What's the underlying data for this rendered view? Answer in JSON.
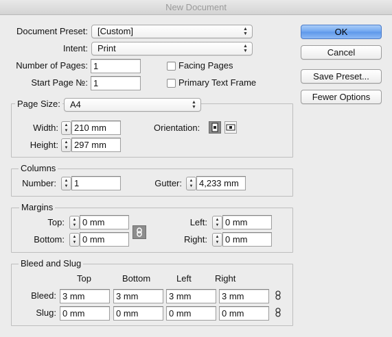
{
  "window": {
    "title": "New Document"
  },
  "document": {
    "preset_label": "Document Preset:",
    "preset_value": "[Custom]",
    "intent_label": "Intent:",
    "intent_value": "Print",
    "pages_label": "Number of Pages:",
    "pages_value": "1",
    "start_page_label": "Start Page №:",
    "start_page_value": "1",
    "facing_pages_label": "Facing Pages",
    "facing_pages_checked": false,
    "primary_text_frame_label": "Primary Text Frame",
    "primary_text_frame_checked": false
  },
  "buttons": {
    "ok": "OK",
    "cancel": "Cancel",
    "save_preset": "Save Preset...",
    "fewer_options": "Fewer Options"
  },
  "page_size": {
    "label": "Page Size:",
    "value": "A4",
    "width_label": "Width:",
    "width_value": "210 mm",
    "height_label": "Height:",
    "height_value": "297 mm",
    "orientation_label": "Orientation:",
    "orientation_selected": "portrait"
  },
  "columns": {
    "title": "Columns",
    "number_label": "Number:",
    "number_value": "1",
    "gutter_label": "Gutter:",
    "gutter_value": "4,233 mm"
  },
  "margins": {
    "title": "Margins",
    "top_label": "Top:",
    "top_value": "0 mm",
    "bottom_label": "Bottom:",
    "bottom_value": "0 mm",
    "left_label": "Left:",
    "left_value": "0 mm",
    "right_label": "Right:",
    "right_value": "0 mm"
  },
  "bleed_slug": {
    "title": "Bleed and Slug",
    "headers": [
      "Top",
      "Bottom",
      "Left",
      "Right"
    ],
    "bleed_label": "Bleed:",
    "bleed_values": [
      "3 mm",
      "3 mm",
      "3 mm",
      "3 mm"
    ],
    "slug_label": "Slug:",
    "slug_values": [
      "0 mm",
      "0 mm",
      "0 mm",
      "0 mm"
    ]
  },
  "icons": {
    "popup_arrows": "updown-arrows-icon",
    "stepper": "stepper-arrows-icon",
    "portrait": "portrait-orientation-icon",
    "landscape": "landscape-orientation-icon",
    "chain": "chain-link-icon"
  },
  "colors": {
    "default_button": "#6fa5ef",
    "dialog_bg": "#ececec"
  }
}
